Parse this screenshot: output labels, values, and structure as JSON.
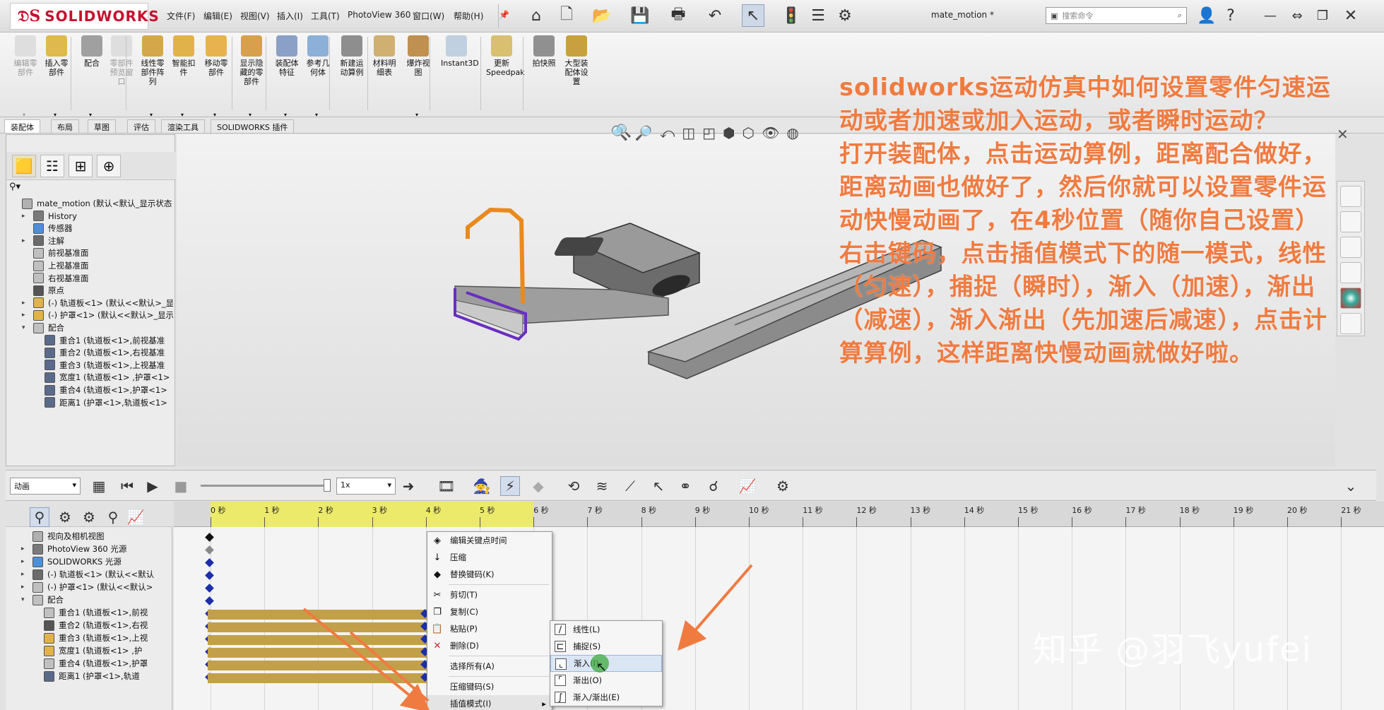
{
  "app": {
    "name": "SOLIDWORKS",
    "doc_title": "mate_motion *"
  },
  "menu": [
    "文件(F)",
    "编辑(E)",
    "视图(V)",
    "插入(I)",
    "工具(T)",
    "PhotoView 360",
    "窗口(W)",
    "帮助(H)"
  ],
  "search_placeholder": "搜索命令",
  "ribbon": [
    {
      "label": "编辑零\n部件",
      "icon": "edit-component-icon",
      "disabled": true
    },
    {
      "label": "插入零\n部件",
      "icon": "insert-component-icon",
      "disabled": false
    },
    {
      "label": "配合",
      "icon": "mate-icon",
      "disabled": false
    },
    {
      "label": "零部件\n预览窗\n口",
      "icon": "preview-window-icon",
      "disabled": true
    },
    {
      "label": "线性零\n部件阵\n列",
      "icon": "pattern-icon",
      "disabled": false
    },
    {
      "label": "智能扣\n件",
      "icon": "fastener-icon",
      "disabled": false
    },
    {
      "label": "移动零\n部件",
      "icon": "move-component-icon",
      "disabled": false
    },
    {
      "label": "显示隐\n藏的零\n部件",
      "icon": "show-hidden-icon",
      "disabled": false
    },
    {
      "label": "装配体\n特征",
      "icon": "assembly-feature-icon",
      "disabled": false
    },
    {
      "label": "参考几\n何体",
      "icon": "reference-geometry-icon",
      "disabled": false
    },
    {
      "label": "新建运\n动算例",
      "icon": "new-motion-study-icon",
      "disabled": false
    },
    {
      "label": "材料明\n细表",
      "icon": "bom-icon",
      "disabled": false
    },
    {
      "label": "爆炸视\n图",
      "icon": "exploded-view-icon",
      "disabled": false
    },
    {
      "label": "Instant3D",
      "icon": "instant3d-icon",
      "disabled": false
    },
    {
      "label": "更新\nSpeedpak",
      "icon": "speedpak-icon",
      "disabled": false
    },
    {
      "label": "拍快照",
      "icon": "snapshot-icon",
      "disabled": false
    },
    {
      "label": "大型装\n配体设\n置",
      "icon": "large-assembly-icon",
      "disabled": false
    }
  ],
  "tabs": [
    "装配体",
    "布局",
    "草图",
    "评估",
    "渲染工具",
    "SOLIDWORKS 插件"
  ],
  "tree": [
    {
      "label": "mate_motion  (默认<默认_显示状态",
      "indent": 0,
      "exp": ""
    },
    {
      "label": "History",
      "indent": 1,
      "exp": "▸"
    },
    {
      "label": "传感器",
      "indent": 1,
      "exp": ""
    },
    {
      "label": "注解",
      "indent": 1,
      "exp": "▸"
    },
    {
      "label": "前视基准面",
      "indent": 1,
      "exp": ""
    },
    {
      "label": "上视基准面",
      "indent": 1,
      "exp": ""
    },
    {
      "label": "右视基准面",
      "indent": 1,
      "exp": ""
    },
    {
      "label": "原点",
      "indent": 1,
      "exp": ""
    },
    {
      "label": "(-) 轨道板<1> (默认<<默认>_显",
      "indent": 1,
      "exp": "▸"
    },
    {
      "label": "(-) 护罩<1> (默认<<默认>_显示",
      "indent": 1,
      "exp": "▸"
    },
    {
      "label": "配合",
      "indent": 1,
      "exp": "▾"
    },
    {
      "label": "重合1 (轨道板<1>,前视基准",
      "indent": 2,
      "exp": ""
    },
    {
      "label": "重合2 (轨道板<1>,右视基准",
      "indent": 2,
      "exp": ""
    },
    {
      "label": "重合3 (轨道板<1>,上视基准",
      "indent": 2,
      "exp": ""
    },
    {
      "label": "宽度1 (轨道板<1> ,护罩<1>",
      "indent": 2,
      "exp": ""
    },
    {
      "label": "重合4 (轨道板<1>,护罩<1>",
      "indent": 2,
      "exp": ""
    },
    {
      "label": "距离1 (护罩<1>,轨道板<1>",
      "indent": 2,
      "exp": ""
    }
  ],
  "motion": {
    "study_type": "动画",
    "speed": "1x",
    "ticks": [
      "0 秒",
      "1 秒",
      "2 秒",
      "3 秒",
      "4 秒",
      "5 秒",
      "6 秒",
      "7 秒",
      "8 秒",
      "9 秒",
      "10 秒",
      "11 秒",
      "12 秒",
      "13 秒",
      "14 秒",
      "15 秒",
      "16 秒",
      "17 秒",
      "18 秒",
      "19 秒",
      "20 秒",
      "21 秒"
    ],
    "highlight_end_seconds": 6,
    "tree": [
      {
        "label": "视向及相机视图",
        "indent": 1,
        "exp": ""
      },
      {
        "label": "PhotoView 360 光源",
        "indent": 1,
        "exp": "▸"
      },
      {
        "label": "SOLIDWORKS 光源",
        "indent": 1,
        "exp": "▸"
      },
      {
        "label": "(-) 轨道板<1> (默认<<默认",
        "indent": 1,
        "exp": "▸"
      },
      {
        "label": "(-) 护罩<1> (默认<<默认>",
        "indent": 1,
        "exp": "▸"
      },
      {
        "label": "配合",
        "indent": 1,
        "exp": "▾"
      },
      {
        "label": "重合1 (轨道板<1>,前视",
        "indent": 2,
        "exp": ""
      },
      {
        "label": "重合2 (轨道板<1>,右视",
        "indent": 2,
        "exp": ""
      },
      {
        "label": "重合3 (轨道板<1>,上视",
        "indent": 2,
        "exp": ""
      },
      {
        "label": "宽度1 (轨道板<1> ,护",
        "indent": 2,
        "exp": ""
      },
      {
        "label": "重合4 (轨道板<1>,护罩",
        "indent": 2,
        "exp": ""
      },
      {
        "label": "距离1 (护罩<1>,轨道",
        "indent": 2,
        "exp": ""
      }
    ]
  },
  "context_menu": [
    {
      "label": "编辑关键点时间",
      "icon": "◈"
    },
    {
      "label": "压缩",
      "icon": "↓"
    },
    {
      "label": "替换键码(K)",
      "icon": "◆"
    },
    {
      "sep": true
    },
    {
      "label": "剪切(T)",
      "icon": "✂"
    },
    {
      "label": "复制(C)",
      "icon": "❐"
    },
    {
      "label": "粘贴(P)",
      "icon": "📋"
    },
    {
      "label": "删除(D)",
      "icon": "✕"
    },
    {
      "sep": true
    },
    {
      "label": "选择所有(A)",
      "icon": ""
    },
    {
      "sep": true
    },
    {
      "label": "压缩键码(S)",
      "icon": ""
    },
    {
      "label": "插值模式(I)",
      "icon": "",
      "submenu": true
    }
  ],
  "submenu": [
    {
      "label": "线性(L)",
      "icon": "∕",
      "selected": false
    },
    {
      "label": "捕捉(S)",
      "icon": "⊏",
      "selected": false
    },
    {
      "label": "渐入(I)",
      "icon": "⌞",
      "selected": true
    },
    {
      "label": "渐出(O)",
      "icon": "⌜",
      "selected": false
    },
    {
      "label": "渐入/渐出(E)",
      "icon": "∫",
      "selected": false
    }
  ],
  "overlay_text": "solidworks运动仿真中如何设置零件匀速运动或者加速或加入运动，或者瞬时运动？\n打开装配体，点击运动算例，距离配合做好，距离动画也做好了，然后你就可以设置零件运动快慢动画了，在4秒位置（随你自己设置）右击键码，点击插值模式下的随一模式，线性（匀速），捕捉（瞬时），渐入（加速），渐出（减速），渐入渐出（先加速后减速），点击计算算例，这样距离快慢动画就做好啦。",
  "watermark": "知乎 @羽飞yufei",
  "colors": {
    "overlay": "#f07b40",
    "key_bar": "#c2a049",
    "ruler_highlight": "#ecea6b",
    "orange_edge": "#e98a1d",
    "purple_edge": "#6a2ec0"
  }
}
